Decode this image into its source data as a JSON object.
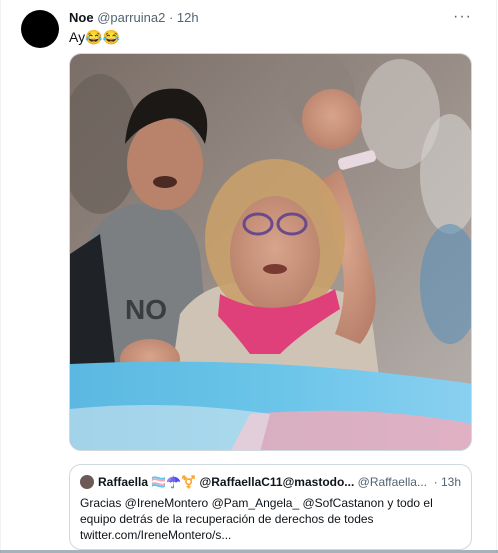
{
  "tweet": {
    "author_name": "Noe",
    "author_handle": "@parruina2",
    "separator": "·",
    "time": "12h",
    "more_label": "···",
    "text": "Ay😂😂"
  },
  "quote": {
    "author_name": "Raffaella 🏳️‍⚧️☂️⚧️",
    "author_handle_bold": "@RaffaellaC11@mastodo...",
    "author_handle": "@Raffaella...",
    "time": "· 13h",
    "body": "Gracias @IreneMontero @Pam_Angela_ @SofCastanon y todo el equipo detrás de la recuperación de derechos de todes",
    "link": "twitter.com/IreneMontero/s..."
  },
  "colors": {
    "flag_blue": "#5bcefa",
    "flag_pink": "#f5a9b8",
    "scarf": "#e0407a",
    "text_secondary": "#536471",
    "border": "#cfd9de"
  }
}
